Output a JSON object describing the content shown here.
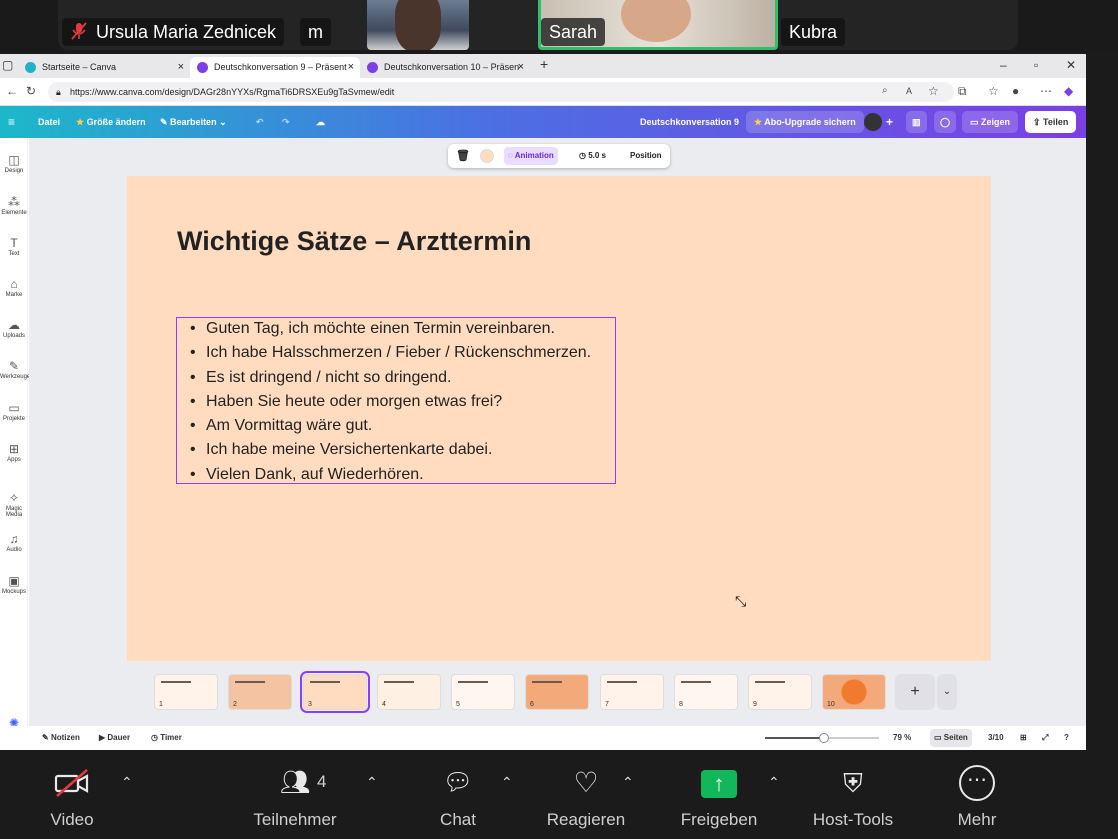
{
  "meeting": {
    "participants_top": [
      {
        "name": "Ursula Maria Zednicek",
        "muted": true
      },
      {
        "name": "m"
      },
      {
        "name": "Sarah",
        "active_speaker": true
      },
      {
        "name": "Kubra"
      }
    ],
    "toolbar": {
      "video_label": "Video",
      "participants_label": "Teilnehmer",
      "participants_count": "4",
      "chat_label": "Chat",
      "react_label": "Reagieren",
      "share_label": "Freigeben",
      "host_tools_label": "Host-Tools",
      "more_label": "Mehr"
    }
  },
  "browser": {
    "tabs": [
      {
        "title": "Startseite – Canva",
        "active": false
      },
      {
        "title": "Deutschkonversation 9 – Präsent",
        "active": true
      },
      {
        "title": "Deutschkonversation 10 – Präsen",
        "active": false
      }
    ],
    "url": "https://www.canva.com/design/DAGr28nYYXs/RgmaTi6DRSXEu9gTaSvmew/edit"
  },
  "canva": {
    "menu": {
      "file": "Datei",
      "resize": "Größe ändern",
      "edit": "Bearbeiten",
      "doc_title": "Deutschkonversation 9",
      "upgrade": "Abo-Upgrade sichern",
      "present": "Zeigen",
      "share": "Teilen"
    },
    "rail": [
      "Design",
      "Elemente",
      "Text",
      "Marke",
      "Uploads",
      "Werkzeuge",
      "Projekte",
      "Apps",
      "Magic Media",
      "Audio",
      "Mockups"
    ],
    "context_bar": {
      "animation": "Animation",
      "duration": "5.0 s",
      "position": "Position"
    },
    "slide": {
      "title": "Wichtige Sätze – Arzttermin",
      "bullets": [
        "Guten Tag, ich möchte einen Termin vereinbaren.",
        "Ich habe Halsschmerzen / Fieber / Rückenschmerzen.",
        "Es ist dringend / nicht so dringend.",
        "Haben Sie heute oder morgen etwas frei?",
        "Am Vormittag wäre gut.",
        "Ich habe meine Versichertenkarte dabei.",
        "Vielen Dank, auf Wiederhören."
      ],
      "background": "#ffdcc0"
    },
    "pages": [
      "1",
      "2",
      "3",
      "4",
      "5",
      "6",
      "7",
      "8",
      "9",
      "10"
    ],
    "current_page": "3",
    "status": {
      "notes": "Notizen",
      "duration": "Dauer",
      "timer": "Timer",
      "zoom": "79 %",
      "pages_label": "Seiten",
      "page_counter": "3/10",
      "zoom_level": 0.52
    }
  },
  "colors": {
    "accent": "#8b3dff",
    "share_green": "#12b75a",
    "speaker_border": "#2ec16b"
  }
}
